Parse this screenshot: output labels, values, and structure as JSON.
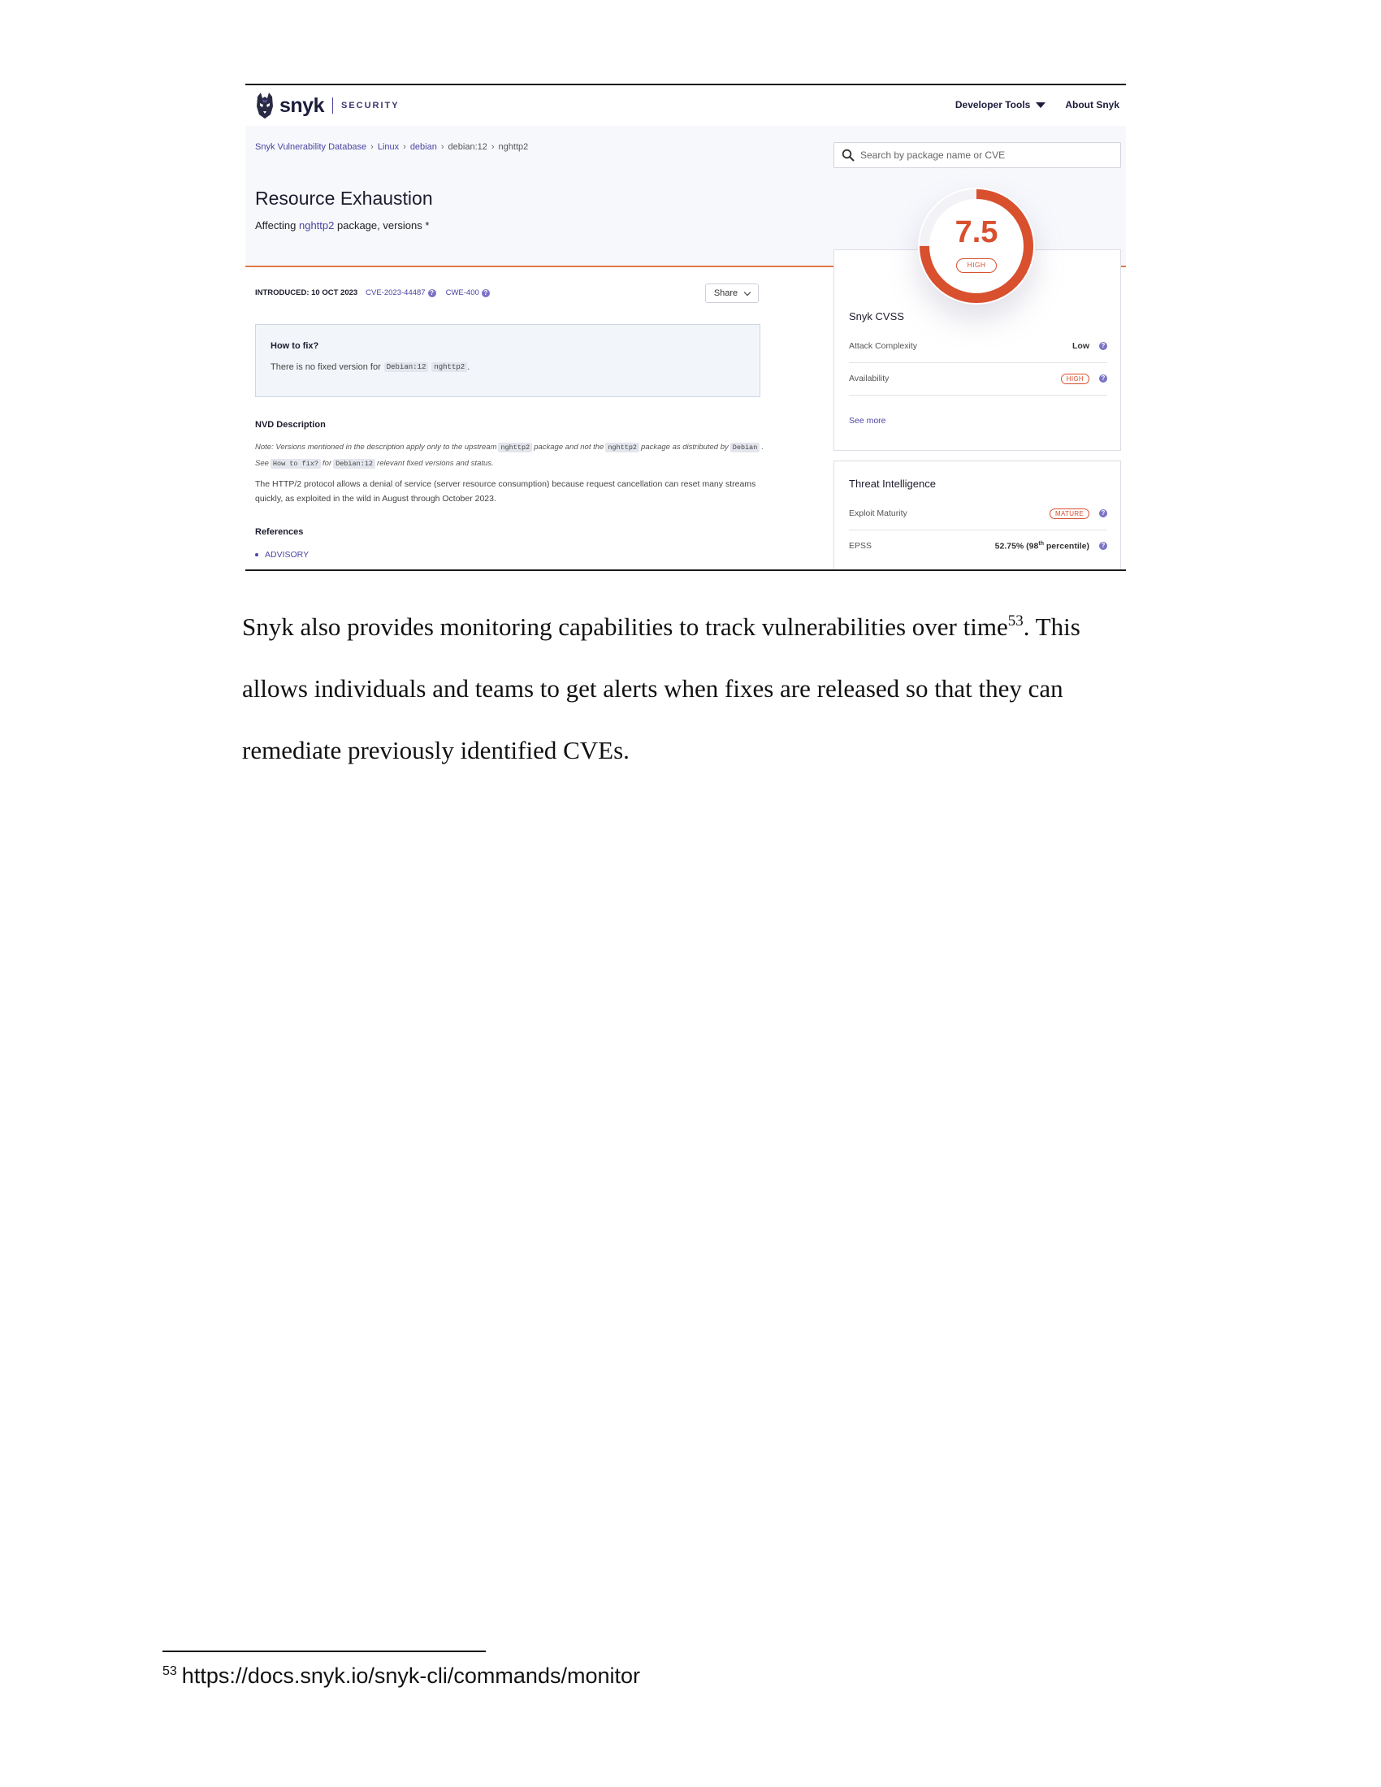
{
  "screenshot": {
    "brand": {
      "wordmark": "snyk",
      "section": "SECURITY"
    },
    "nav": {
      "developer_tools": "Developer Tools",
      "about": "About Snyk"
    },
    "breadcrumbs": {
      "db": "Snyk Vulnerability Database",
      "linux": "Linux",
      "debian": "debian",
      "debian12": "debian:12",
      "pkg": "nghttp2",
      "sep": "›"
    },
    "search": {
      "placeholder": "Search by package name or CVE"
    },
    "title": "Resource Exhaustion",
    "affecting": {
      "prefix": "Affecting",
      "package": "nghttp2",
      "suffix": "package, versions *"
    },
    "meta": {
      "introduced": "INTRODUCED: 10 OCT 2023",
      "cve": "CVE-2023-44487",
      "cwe": "CWE-400"
    },
    "share_label": "Share",
    "how_to_fix": {
      "heading": "How to fix?",
      "text": "There is no fixed version for",
      "code1": "Debian:12",
      "code2": "nghttp2",
      "end": "."
    },
    "nvd": {
      "heading": "NVD Description",
      "note": {
        "t1": "Note: Versions mentioned in the description apply only to the upstream",
        "c1": "nghttp2",
        "t2": "package and not the",
        "c2": "nghttp2",
        "t3": "package as distributed by",
        "c3": "Debian",
        "t4": ". See",
        "c4": "How to fix?",
        "t5": "for",
        "c5": "Debian:12",
        "t6": "relevant fixed versions and status."
      },
      "description": "The HTTP/2 protocol allows a denial of service (server resource consumption) because request cancellation can reset many streams quickly, as exploited in the wild in August through October 2023."
    },
    "references": {
      "heading": "References",
      "items": [
        "ADVISORY"
      ]
    },
    "score": {
      "value": "7.5",
      "severity": "HIGH",
      "fraction": 0.75,
      "color": "#d9502f"
    },
    "cvss": {
      "heading": "Snyk CVSS",
      "rows": [
        {
          "label": "Attack Complexity",
          "value": "Low"
        },
        {
          "label": "Availability",
          "value": "HIGH"
        }
      ],
      "see_more": "See more"
    },
    "threat": {
      "heading": "Threat Intelligence",
      "rows": [
        {
          "label": "Exploit Maturity",
          "value": "MATURE"
        },
        {
          "label": "EPSS",
          "value_prefix": "52.75% (98",
          "value_sup": "th",
          "value_suffix": " percentile)"
        }
      ]
    },
    "colors": {
      "brand_purple": "#4b45a1",
      "severity": "#d9502f",
      "hero_bg": "#f7f8fc"
    }
  },
  "document": {
    "lines": [
      {
        "text": "Snyk also provides monitoring capabilities to track vulnerabilities over time",
        "sup": "53",
        "after": ". This"
      },
      {
        "text": "allows individuals and teams to get alerts when fixes are released so that they can"
      },
      {
        "text": "remediate previously identified CVEs."
      }
    ],
    "footnote": {
      "number": "53",
      "text": "https://docs.snyk.io/snyk-cli/commands/monitor"
    }
  }
}
